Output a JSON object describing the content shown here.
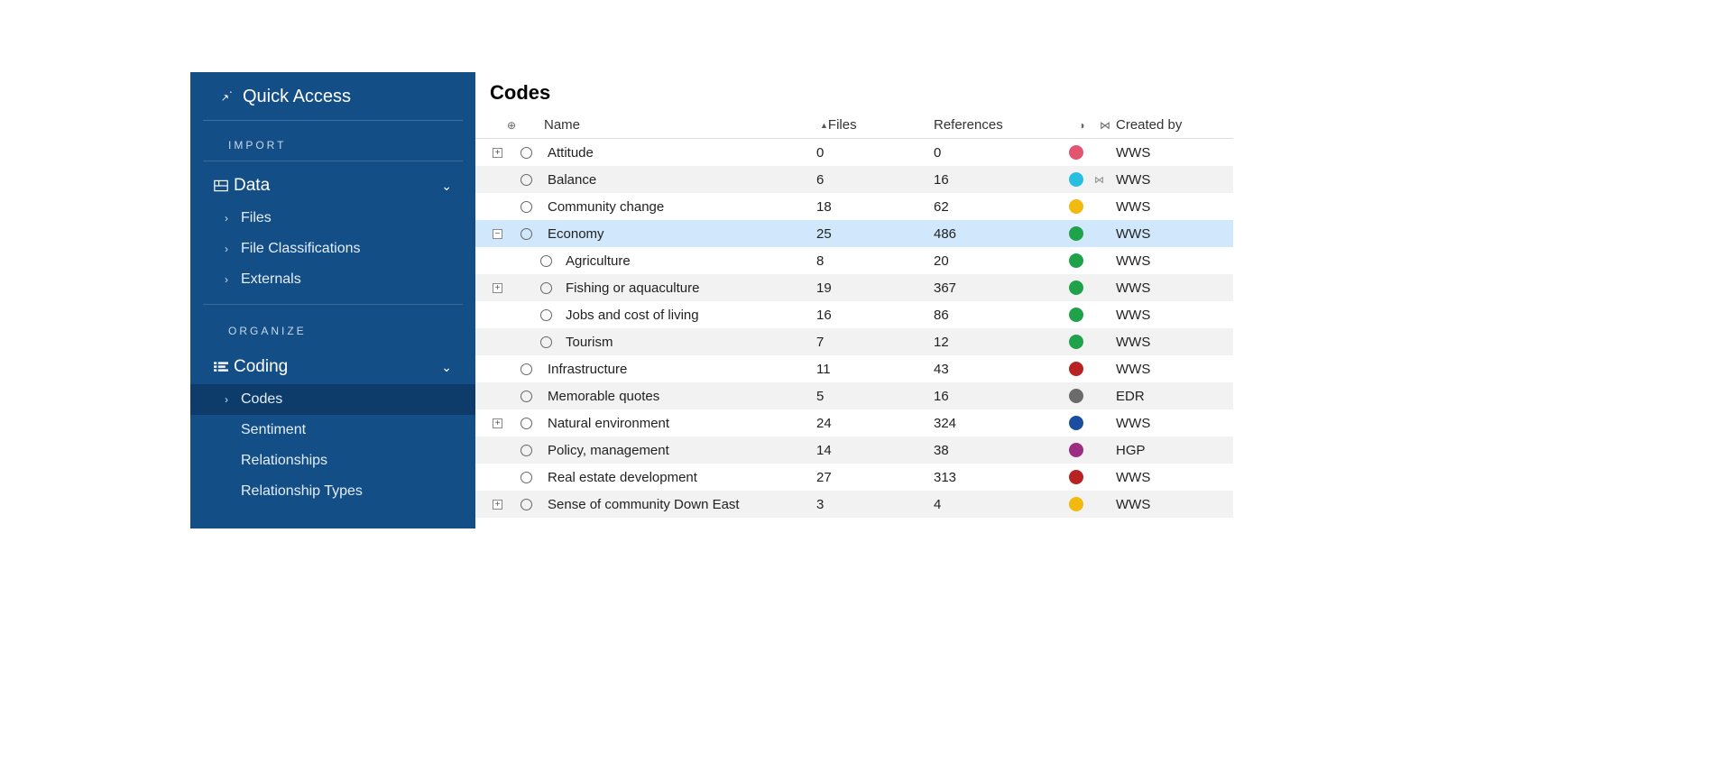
{
  "sidebar": {
    "quick_access": "Quick Access",
    "import_label": "IMPORT",
    "organize_label": "ORGANIZE",
    "data_group": {
      "label": "Data",
      "items": [
        {
          "label": "Files",
          "has_chevron": true,
          "active": false
        },
        {
          "label": "File Classifications",
          "has_chevron": true,
          "active": false
        },
        {
          "label": "Externals",
          "has_chevron": true,
          "active": false
        }
      ]
    },
    "coding_group": {
      "label": "Coding",
      "items": [
        {
          "label": "Codes",
          "has_chevron": true,
          "active": true
        },
        {
          "label": "Sentiment",
          "has_chevron": false,
          "active": false
        },
        {
          "label": "Relationships",
          "has_chevron": false,
          "active": false
        },
        {
          "label": "Relationship Types",
          "has_chevron": false,
          "active": false
        }
      ]
    }
  },
  "main": {
    "title": "Codes",
    "columns": {
      "name": "Name",
      "files": "Files",
      "references": "References",
      "created_by": "Created by"
    },
    "rows": [
      {
        "expander": "+",
        "indent": 0,
        "name": "Attitude",
        "files": "0",
        "refs": "0",
        "color": "#e25470",
        "link": false,
        "created_by": "WWS",
        "stripe": false,
        "selected": false
      },
      {
        "expander": "",
        "indent": 0,
        "name": "Balance",
        "files": "6",
        "refs": "16",
        "color": "#27bfe1",
        "link": true,
        "created_by": "WWS",
        "stripe": true,
        "selected": false
      },
      {
        "expander": "",
        "indent": 0,
        "name": "Community change",
        "files": "18",
        "refs": "62",
        "color": "#f2b90f",
        "link": false,
        "created_by": "WWS",
        "stripe": false,
        "selected": false
      },
      {
        "expander": "-",
        "indent": 0,
        "name": "Economy",
        "files": "25",
        "refs": "486",
        "color": "#1fa24a",
        "link": false,
        "created_by": "WWS",
        "stripe": false,
        "selected": true
      },
      {
        "expander": "",
        "indent": 1,
        "name": "Agriculture",
        "files": "8",
        "refs": "20",
        "color": "#1fa24a",
        "link": false,
        "created_by": "WWS",
        "stripe": false,
        "selected": false
      },
      {
        "expander": "+",
        "indent": 1,
        "name": "Fishing or aquaculture",
        "files": "19",
        "refs": "367",
        "color": "#1fa24a",
        "link": false,
        "created_by": "WWS",
        "stripe": true,
        "selected": false
      },
      {
        "expander": "",
        "indent": 1,
        "name": "Jobs and cost of living",
        "files": "16",
        "refs": "86",
        "color": "#1fa24a",
        "link": false,
        "created_by": "WWS",
        "stripe": false,
        "selected": false
      },
      {
        "expander": "",
        "indent": 1,
        "name": "Tourism",
        "files": "7",
        "refs": "12",
        "color": "#1fa24a",
        "link": false,
        "created_by": "WWS",
        "stripe": true,
        "selected": false
      },
      {
        "expander": "",
        "indent": 0,
        "name": "Infrastructure",
        "files": "11",
        "refs": "43",
        "color": "#b82222",
        "link": false,
        "created_by": "WWS",
        "stripe": false,
        "selected": false
      },
      {
        "expander": "",
        "indent": 0,
        "name": "Memorable quotes",
        "files": "5",
        "refs": "16",
        "color": "#6b6b6b",
        "link": false,
        "created_by": "EDR",
        "stripe": true,
        "selected": false
      },
      {
        "expander": "+",
        "indent": 0,
        "name": "Natural environment",
        "files": "24",
        "refs": "324",
        "color": "#1b4ea0",
        "link": false,
        "created_by": "WWS",
        "stripe": false,
        "selected": false
      },
      {
        "expander": "",
        "indent": 0,
        "name": "Policy, management",
        "files": "14",
        "refs": "38",
        "color": "#9b2d83",
        "link": false,
        "created_by": "HGP",
        "stripe": true,
        "selected": false
      },
      {
        "expander": "",
        "indent": 0,
        "name": "Real estate development",
        "files": "27",
        "refs": "313",
        "color": "#b82222",
        "link": false,
        "created_by": "WWS",
        "stripe": false,
        "selected": false
      },
      {
        "expander": "+",
        "indent": 0,
        "name": "Sense of community Down East",
        "files": "3",
        "refs": "4",
        "color": "#f2b90f",
        "link": false,
        "created_by": "WWS",
        "stripe": true,
        "selected": false
      }
    ]
  }
}
